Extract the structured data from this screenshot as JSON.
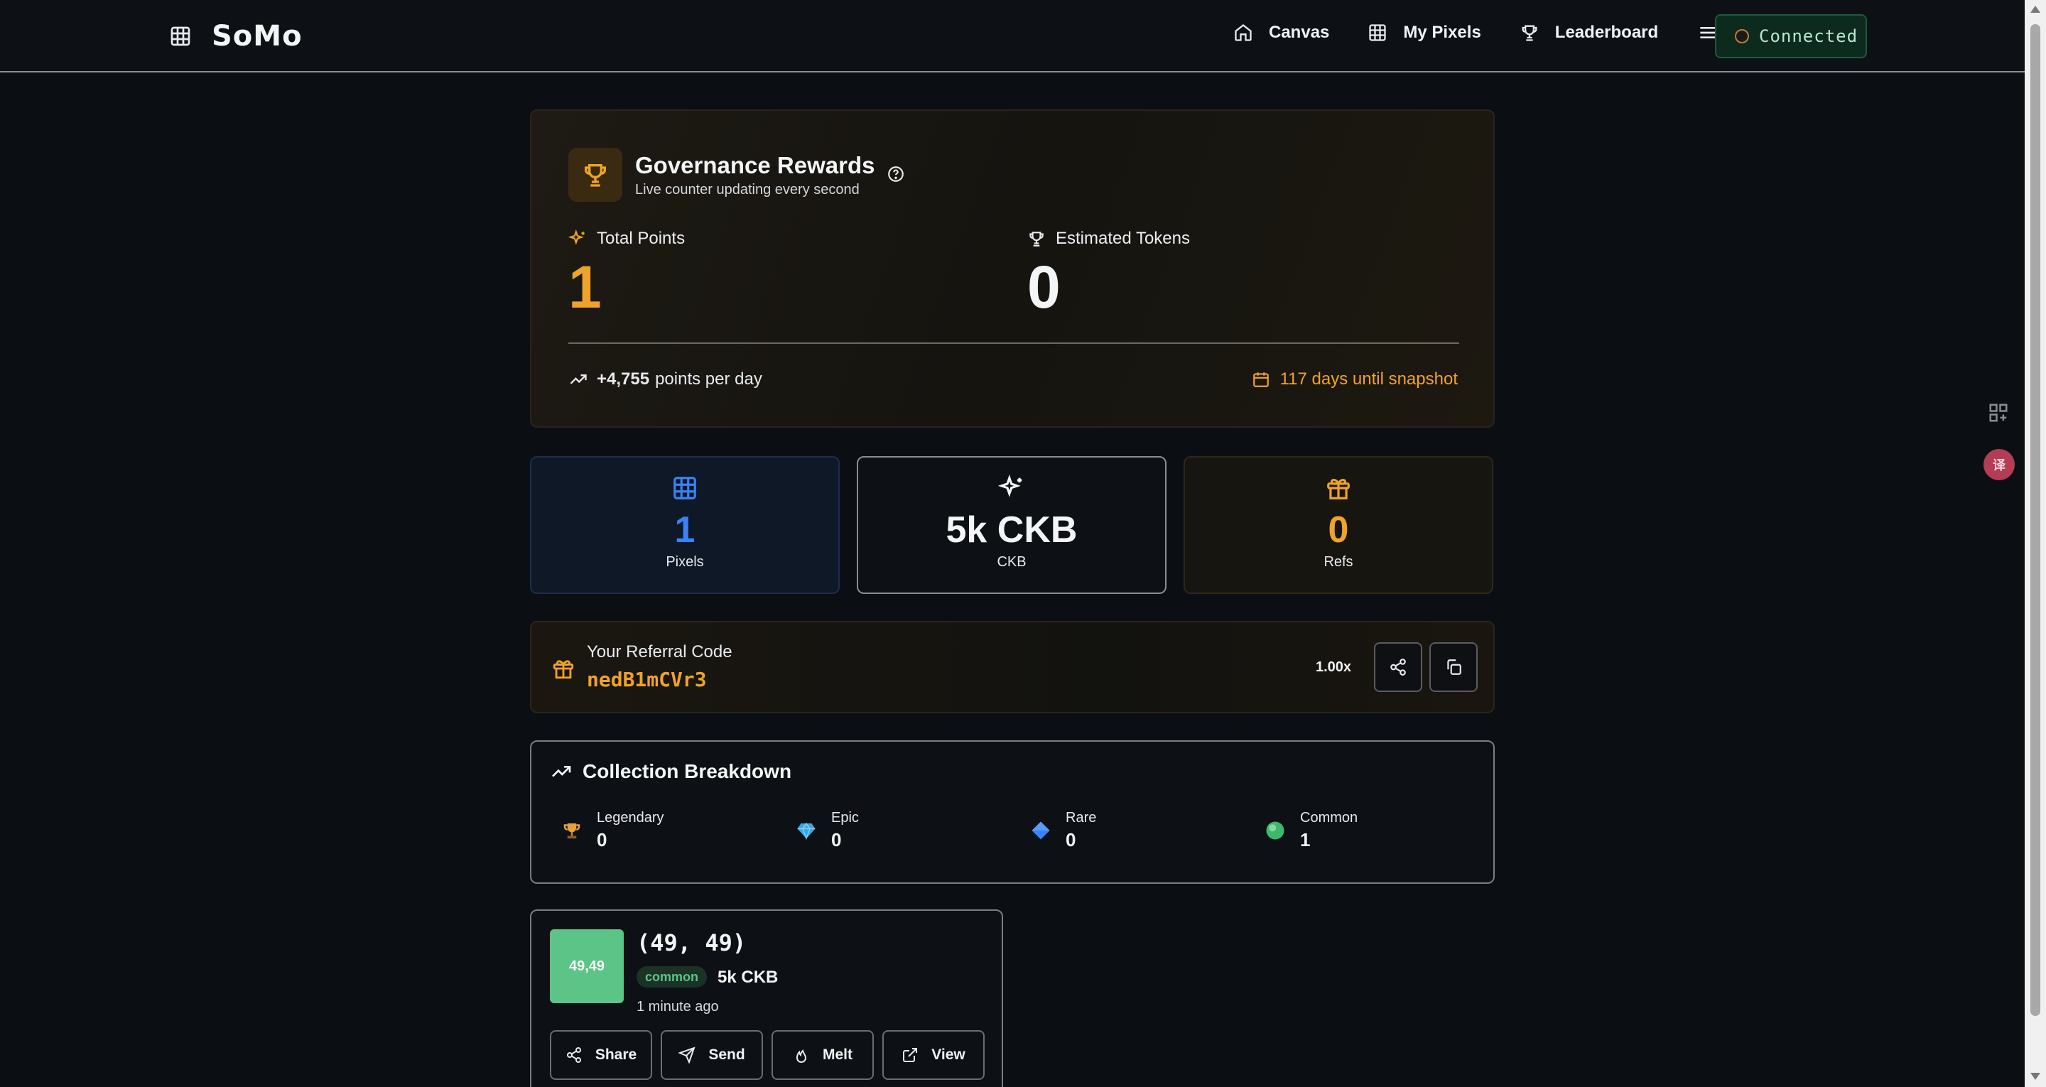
{
  "header": {
    "brand": "SoMo",
    "nav": [
      {
        "label": "Canvas",
        "icon": "home-icon"
      },
      {
        "label": "My Pixels",
        "icon": "grid-icon"
      },
      {
        "label": "Leaderboard",
        "icon": "trophy-icon"
      }
    ],
    "connect_label": "Connected"
  },
  "governance": {
    "title": "Governance Rewards",
    "subtitle": "Live counter updating every second",
    "total_points_label": "Total Points",
    "total_points": "1",
    "est_tokens_label": "Estimated Tokens",
    "est_tokens": "0",
    "rate_value": "+4,755",
    "rate_suffix": "points per day",
    "snapshot": "117 days until snapshot"
  },
  "stats": {
    "pixels_value": "1",
    "pixels_label": "Pixels",
    "ckb_value": "5k CKB",
    "ckb_label": "CKB",
    "refs_value": "0",
    "refs_label": "Refs"
  },
  "referral": {
    "label": "Your Referral Code",
    "code": "nedB1mCVr3",
    "multiplier": "1.00x"
  },
  "collection": {
    "title": "Collection Breakdown",
    "items": [
      {
        "name": "Legendary",
        "count": "0"
      },
      {
        "name": "Epic",
        "count": "0"
      },
      {
        "name": "Rare",
        "count": "0"
      },
      {
        "name": "Common",
        "count": "1"
      }
    ]
  },
  "pixel": {
    "swatch_label": "49,49",
    "coord": "(49, 49)",
    "rarity": "common",
    "price": "5k CKB",
    "ago": "1 minute ago",
    "actions": [
      "Share",
      "Send",
      "Melt",
      "View"
    ]
  },
  "colors": {
    "accent_orange": "#f0a32a",
    "accent_blue": "#3b82f6",
    "accent_green": "#5cc486"
  },
  "side": {
    "translate_label": "译"
  }
}
